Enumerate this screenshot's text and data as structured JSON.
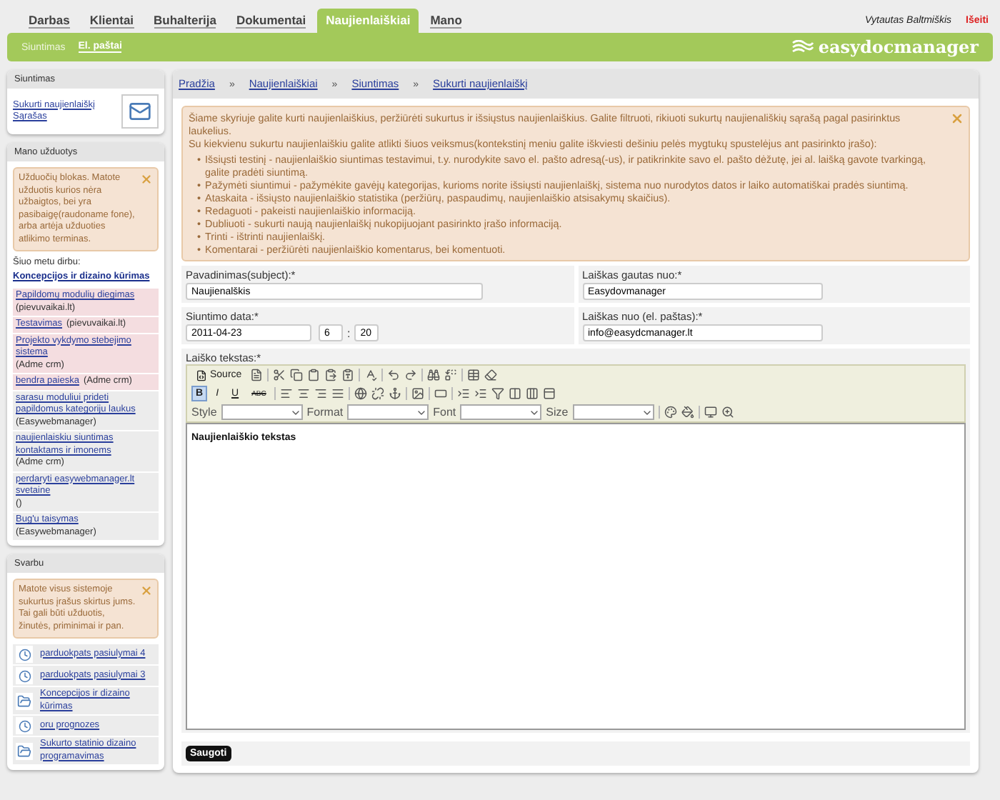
{
  "nav": {
    "tabs": [
      {
        "label": "Darbas",
        "selected": false
      },
      {
        "label": "Klientai",
        "selected": false
      },
      {
        "label": "Buhalterija",
        "selected": false
      },
      {
        "label": "Dokumentai",
        "selected": false
      },
      {
        "label": "Naujienlaiškiai",
        "selected": true
      },
      {
        "label": "Mano",
        "selected": false
      }
    ],
    "user": "Vytautas Baltmiškis",
    "logout": "Išeiti"
  },
  "subnav": {
    "items": [
      {
        "label": "Siuntimas",
        "selected": false
      },
      {
        "label": "El. paštai",
        "selected": true
      }
    ],
    "logo": "easydocmanager"
  },
  "sidebar": {
    "sending": {
      "title": "Siuntimas",
      "links": [
        "Sukurti naujienlaiškį",
        "Sąrašas"
      ]
    },
    "tasks": {
      "title": "Mano užduotys",
      "notice": "Užduočių blokas. Matote užduotis kurios nėra užbaigtos, bei yra pasibaigę(raudoname fone), arba artėja užduoties atlikimo terminas.",
      "current_label": "Šiuo metu dirbu:",
      "current_task": "Koncepcijos ir dizaino kūrimas",
      "items": [
        {
          "title": "Papildomų modulių diegimas",
          "project": "(pievuvaikai.lt)",
          "overdue": true
        },
        {
          "title": "Testavimas",
          "project": "(pievuvaikai.lt)",
          "overdue": true
        },
        {
          "title": "Projekto vykdymo stebejimo sistema",
          "project": "(Adme crm)",
          "overdue": true
        },
        {
          "title": "bendra paieska",
          "project": "(Adme crm)",
          "overdue": true
        },
        {
          "title": "sarasu moduliui prideti papildomus kategoriju laukus",
          "project": "(Easywebmanager)",
          "overdue": false
        },
        {
          "title": "naujienlaiskiu siuntimas kontaktams ir imonems",
          "project": "(Adme crm)",
          "overdue": false
        },
        {
          "title": "perdaryti easywebmanager.lt svetaine",
          "project": "()",
          "overdue": false
        },
        {
          "title": "Bug'u taisymas",
          "project": "(Easywebmanager)",
          "overdue": false
        }
      ]
    },
    "important": {
      "title": "Svarbu",
      "notice": "Matote visus sistemoje sukurtus įrašus skirtus jums. Tai gali būti užduotis, žinutės, priminimai ir pan.",
      "items": [
        {
          "kind": "reminder",
          "title": "parduokpats pasiulymai 4"
        },
        {
          "kind": "reminder",
          "title": "parduokpats pasiulymai 3"
        },
        {
          "kind": "task",
          "title": "Koncepcijos ir dizaino kūrimas"
        },
        {
          "kind": "reminder",
          "title": "oru prognozes"
        },
        {
          "kind": "task",
          "title": "Sukurto statinio dizaino programavimas"
        }
      ]
    }
  },
  "breadcrumb": [
    {
      "label": "Pradžia"
    },
    {
      "sep": "»",
      "label": "Naujienlaiškiai"
    },
    {
      "sep": "»",
      "label": "Siuntimas"
    },
    {
      "sep": "»",
      "label": "Sukurti naujienlaiškį"
    }
  ],
  "info": {
    "lines": [
      "Šiame skyriuje galite kurti naujienlaiškius, peržiūrėti sukurtus ir išsiųstus naujienlaiškius. Galite filtruoti, rikiuoti sukurtų naujienališkių sąrašą pagal pasirinktus laukelius.",
      "Su kiekvienu sukurtu naujienlaiškiu galite atlikti šiuos veiksmus(kontekstinį meniu galite iškviesti dešiniu pelės mygtukų spustelėjus ant pasirinkto įrašo):"
    ],
    "bullets": [
      {
        "mark": "•",
        "text": "Išsiųsti testinį - naujienlaiškio siuntimas testavimui, t.y. nurodykite savo el. pašto adresą(-us), ir patikrinkite savo el. pašto dėžutę, jei al. laišką gavote tvarkingą, galite pradėti siuntimą."
      },
      {
        "mark": "•",
        "text": "Pažymėti siuntimui - pažymėkite gavėjų kategorijas, kurioms norite išsiųsti naujienlaiškį, sistema nuo nurodytos datos ir laiko automatiškai pradės siuntimą."
      },
      {
        "mark": "•",
        "text": "Ataskaita - išsiųsto naujienlaiškio statistika (peržiūrų, paspaudimų, naujienlaiškio atsisakymų skaičius)."
      },
      {
        "mark": "•",
        "text": "Redaguoti - pakeisti naujienlaiškio informaciją."
      },
      {
        "mark": "•",
        "text": "Dubliuoti - sukurti naują naujienlaiškį nukopijuojant pasirinkto įrašo informaciją."
      },
      {
        "mark": "•",
        "text": "Trinti - ištrinti naujienlaiškį."
      },
      {
        "mark": "•",
        "text": "Komentarai - peržiūrėti naujienlaiškio komentarus, bei komentuoti."
      }
    ]
  },
  "form": {
    "subject": {
      "label": "Pavadinimas(subject):*",
      "value": "Naujienalškis"
    },
    "from_name": {
      "label": "Laiškas gautas nuo:*",
      "value": "Easydovmanager"
    },
    "send_date": {
      "label": "Siuntimo data:*",
      "value": "2011-04-23",
      "hour": "6",
      "separator": ":",
      "minute": "20"
    },
    "from_email": {
      "label": "Laiškas nuo (el. paštas):*",
      "value": "info@easydcmanager.lt"
    },
    "body": {
      "label": "Laiško tekstas:*",
      "source": "Source",
      "format_buttons": [
        {
          "label": "B",
          "selected": true
        },
        {
          "label": "I",
          "selected": false
        },
        {
          "label": "U",
          "selected": false
        },
        {
          "label": "ABC",
          "selected": false
        }
      ],
      "combos": [
        "Style",
        "Format",
        "Font",
        "Size"
      ],
      "content": "Naujienlaiškio tekstas"
    },
    "save": "Saugoti"
  }
}
